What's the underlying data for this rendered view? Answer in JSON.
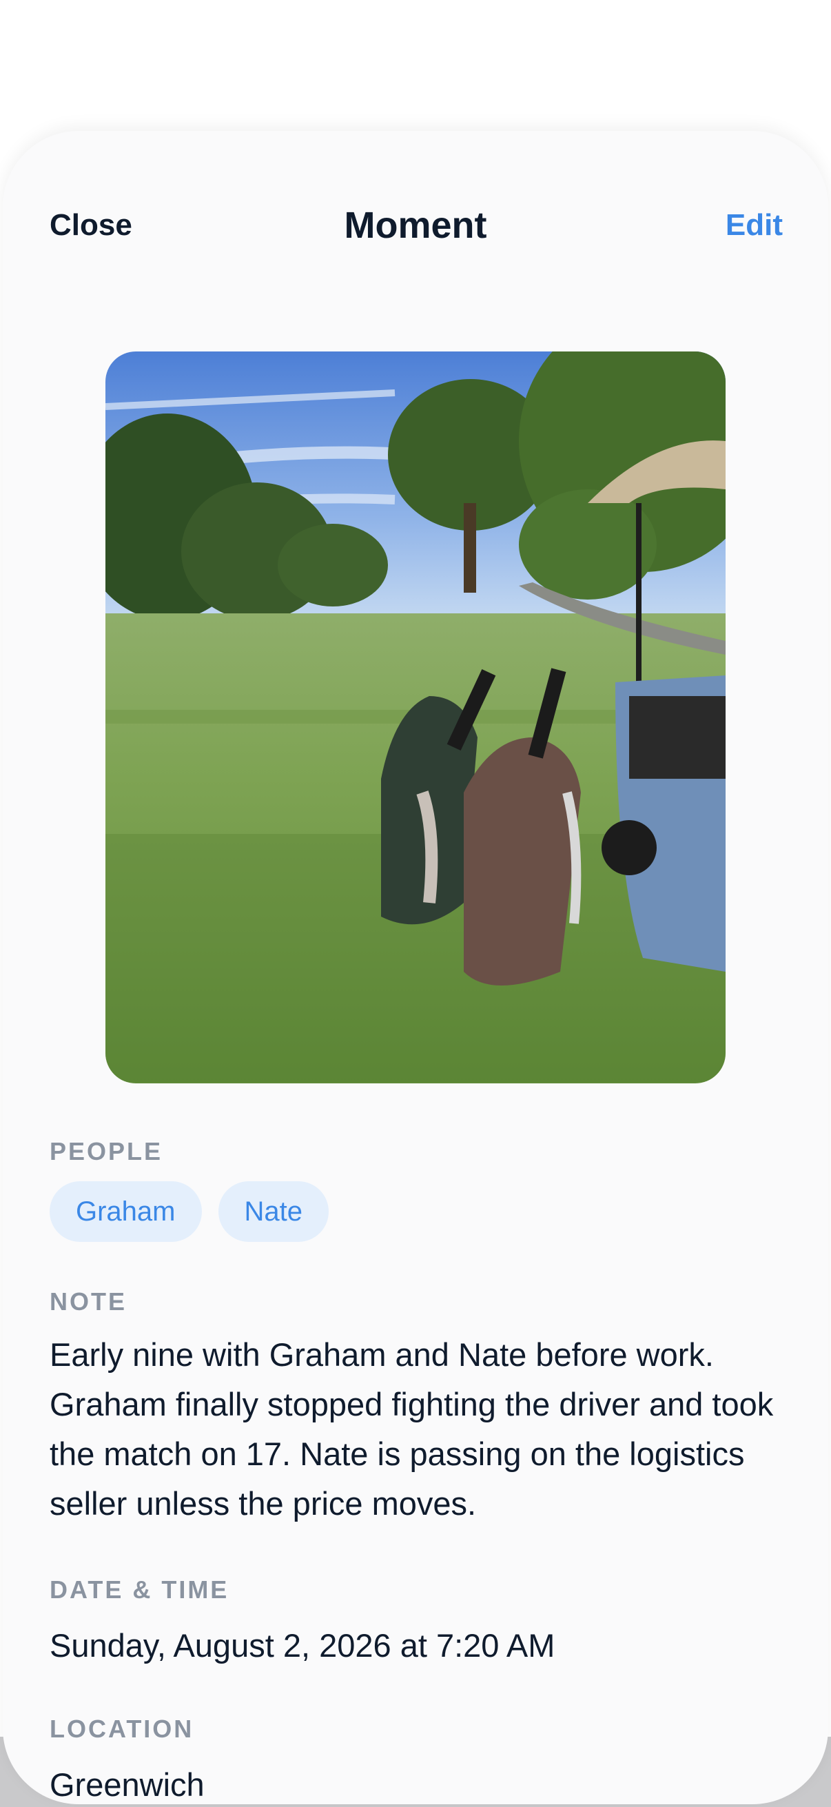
{
  "nav": {
    "close_label": "Close",
    "title": "Moment",
    "edit_label": "Edit"
  },
  "photo": {
    "subject": "golf-bags-on-fairway-photo"
  },
  "people": {
    "label": "PEOPLE",
    "items": [
      {
        "name": "Graham"
      },
      {
        "name": "Nate"
      }
    ]
  },
  "note": {
    "label": "NOTE",
    "text": "Early nine with Graham and Nate before work. Graham finally stopped fighting the driver and took the match on 17. Nate is passing on the logistics seller unless the price moves."
  },
  "datetime": {
    "label": "DATE & TIME",
    "value": "Sunday, August 2, 2026 at 7:20 AM"
  },
  "location": {
    "label": "LOCATION",
    "value": "Greenwich"
  },
  "colors": {
    "accent": "#3a87e6",
    "text_primary": "#0f1b2d",
    "label_gray": "#8a93a0",
    "chip_bg": "#e4effc",
    "sheet_bg": "#fafafb"
  }
}
